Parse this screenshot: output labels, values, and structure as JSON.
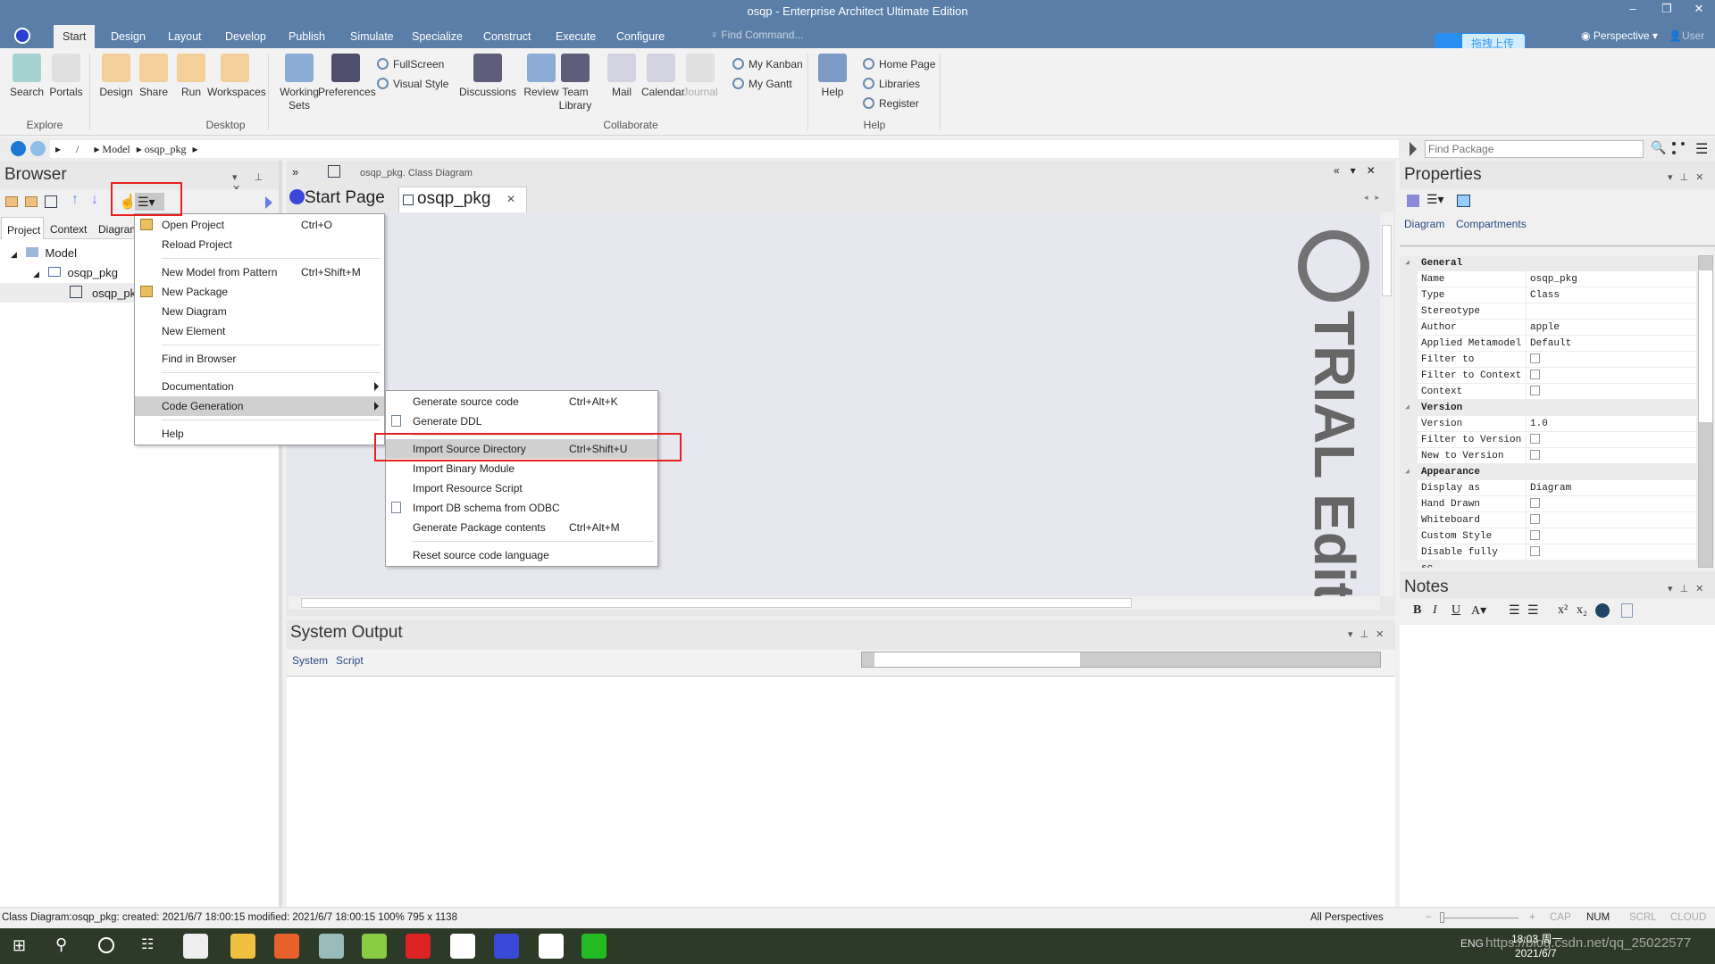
{
  "window": {
    "title": "osqp - Enterprise Architect Ultimate Edition",
    "minimize": "–",
    "restore": "❐",
    "close": "✕"
  },
  "ribbon_tabs": [
    "Start",
    "Design",
    "Layout",
    "Develop",
    "Publish",
    "Simulate",
    "Specialize",
    "Construct",
    "Execute",
    "Configure"
  ],
  "find_command": "Find Command...",
  "upload_badge": "拖拽上传",
  "perspective": "Perspective",
  "user": "User",
  "ribbon": {
    "explore": {
      "label": "Explore",
      "buttons": [
        "Search",
        "Portals"
      ]
    },
    "desktop": {
      "label": "Desktop",
      "buttons": [
        "Design",
        "Share",
        "Run",
        "Workspaces",
        "Working Sets",
        "Preferences"
      ],
      "small": [
        "FullScreen",
        "Visual Style"
      ]
    },
    "collaborate": {
      "label": "Collaborate",
      "buttons": [
        "Discussions",
        "Review",
        "Team Library",
        "Mail",
        "Calendar",
        "Journal"
      ],
      "small": [
        "My Kanban",
        "My Gantt"
      ]
    },
    "help": {
      "label": "Help",
      "buttons": [
        "Help"
      ],
      "small": [
        "Home Page",
        "Libraries",
        "Register"
      ]
    }
  },
  "breadcrumb": [
    "/",
    "Model",
    "osqp_pkg"
  ],
  "find_package_placeholder": "Find Package",
  "browser": {
    "title": "Browser",
    "tabs": [
      "Project",
      "Context",
      "Diagram"
    ],
    "tree": [
      {
        "label": "Model",
        "level": 0
      },
      {
        "label": "osqp_pkg",
        "level": 1
      },
      {
        "label": "osqp_pkg",
        "level": 2
      }
    ]
  },
  "context_menu": [
    {
      "label": "Open Project",
      "shortcut": "Ctrl+O",
      "icon": "folder-open-icon"
    },
    {
      "label": "Reload Project",
      "shortcut": ""
    },
    {
      "sep": true
    },
    {
      "label": "New Model from Pattern",
      "shortcut": "Ctrl+Shift+M"
    },
    {
      "label": "New Package",
      "shortcut": "",
      "icon": "new-package-icon"
    },
    {
      "label": "New Diagram",
      "shortcut": ""
    },
    {
      "label": "New Element",
      "shortcut": ""
    },
    {
      "sep": true
    },
    {
      "label": "Find in Browser",
      "shortcut": ""
    },
    {
      "sep": true
    },
    {
      "label": "Documentation",
      "shortcut": "",
      "submenu": true
    },
    {
      "label": "Code Generation",
      "shortcut": "",
      "submenu": true,
      "highlighted": true
    },
    {
      "sep": true
    },
    {
      "label": "Help",
      "shortcut": ""
    }
  ],
  "submenu": [
    {
      "label": "Generate source code",
      "shortcut": "Ctrl+Alt+K"
    },
    {
      "label": "Generate DDL",
      "shortcut": "",
      "icon": "document-icon"
    },
    {
      "sep": true
    },
    {
      "label": "Import Source Directory",
      "shortcut": "Ctrl+Shift+U",
      "highlighted": true
    },
    {
      "label": "Import Binary Module",
      "shortcut": ""
    },
    {
      "label": "Import Resource Script",
      "shortcut": ""
    },
    {
      "label": "Import DB schema from ODBC",
      "shortcut": "",
      "icon": "document-icon"
    },
    {
      "label": "Generate Package contents",
      "shortcut": "Ctrl+Alt+M"
    },
    {
      "sep": true
    },
    {
      "label": "Reset source code language",
      "shortcut": ""
    }
  ],
  "diagram": {
    "caption": "osqp_pkg.  Class Diagram",
    "tabs": [
      "Start Page",
      "osqp_pkg"
    ],
    "watermark": "TRIAL Edition"
  },
  "system_output": {
    "title": "System Output",
    "tabs": [
      "System",
      "Script"
    ]
  },
  "properties": {
    "title": "Properties",
    "tabs": [
      "Diagram",
      "Compartments"
    ],
    "rows": [
      {
        "cat": "General"
      },
      {
        "k": "Name",
        "v": "osqp_pkg"
      },
      {
        "k": "Type",
        "v": "Class"
      },
      {
        "k": "Stereotype",
        "v": ""
      },
      {
        "k": "Author",
        "v": "apple"
      },
      {
        "k": "Applied Metamodel",
        "v": "Default"
      },
      {
        "k": "Filter to Metamodel",
        "check": false
      },
      {
        "k": "Filter to Context",
        "check": false
      },
      {
        "k": "Context Navigation",
        "check": false
      },
      {
        "cat": "Version"
      },
      {
        "k": "Version",
        "v": "1.0"
      },
      {
        "k": "Filter to Version",
        "check": false
      },
      {
        "k": "New to Version",
        "check": false
      },
      {
        "cat": "Appearance"
      },
      {
        "k": "Display as",
        "v": "Diagram"
      },
      {
        "k": "Hand Drawn",
        "check": false
      },
      {
        "k": "Whiteboard",
        "check": false
      },
      {
        "k": "Custom Style",
        "check": false
      },
      {
        "k": "Disable fully sc...",
        "check": false
      }
    ]
  },
  "notes": {
    "title": "Notes",
    "toolbar": [
      "B",
      "I",
      "U"
    ]
  },
  "status": {
    "left": "Class Diagram:osqp_pkg:   created: 2021/6/7 18:00:15  modified: 2021/6/7 18:00:15   100%   795 x 1138",
    "perspectives": "All Perspectives",
    "indicators": [
      "CAP",
      "NUM",
      "SCRL",
      "CLOUD"
    ],
    "zoom_level": 0
  },
  "taskbar": {
    "time": "18:03 周一",
    "date": "2021/6/7",
    "lang": "ENG",
    "watermark": "https://blog.csdn.net/qq_25022577"
  }
}
